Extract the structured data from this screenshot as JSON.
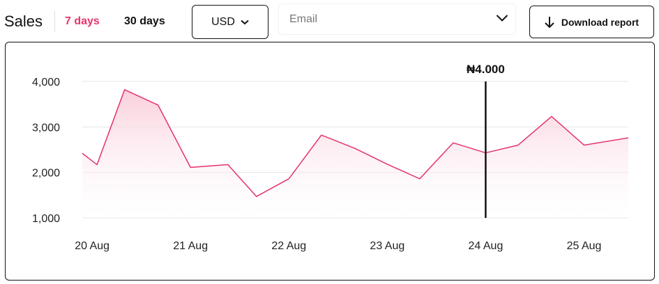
{
  "header": {
    "title": "Sales",
    "tabs": [
      {
        "label": "7 days",
        "active": true
      },
      {
        "label": "30 days",
        "active": false
      }
    ],
    "currency": {
      "value": "USD"
    },
    "email_filter": {
      "placeholder": "Email"
    },
    "download_label": "Download report"
  },
  "colors": {
    "accent": "#e8336b",
    "line": "#e4346a",
    "area_top": "#f9c9d7",
    "grid": "#e5e5e5",
    "marker": "#111111"
  },
  "icons": {
    "currency": "chevron-down-icon",
    "email": "chevron-down-icon",
    "download": "arrow-down-icon"
  },
  "chart_data": {
    "type": "area",
    "title": "",
    "xlabel": "",
    "ylabel": "",
    "ylim": [
      1000,
      4000
    ],
    "yticks": [
      1000,
      2000,
      3000,
      4000
    ],
    "ytick_labels": [
      "1,000",
      "2,000",
      "3,000",
      "4,000"
    ],
    "x_range": [
      19.9,
      25.45
    ],
    "xticks": [
      20,
      21,
      22,
      23,
      24,
      25
    ],
    "xtick_labels": [
      "20 Aug",
      "21 Aug",
      "22 Aug",
      "23 Aug",
      "24 Aug",
      "25 Aug"
    ],
    "grid": true,
    "series": [
      {
        "x": [
          19.9,
          20.05,
          20.33,
          20.67,
          21.0,
          21.38,
          21.67,
          22.0,
          22.33,
          22.67,
          23.0,
          23.33,
          23.67,
          24.0,
          24.33,
          24.67,
          25.0,
          25.45
        ],
        "values": [
          2420,
          2170,
          3820,
          3480,
          2110,
          2170,
          1470,
          1860,
          2820,
          2530,
          2180,
          1860,
          2650,
          2430,
          2600,
          3230,
          2600,
          2760
        ]
      }
    ],
    "marker": {
      "x": 24.0,
      "label": "₦4.000"
    }
  }
}
